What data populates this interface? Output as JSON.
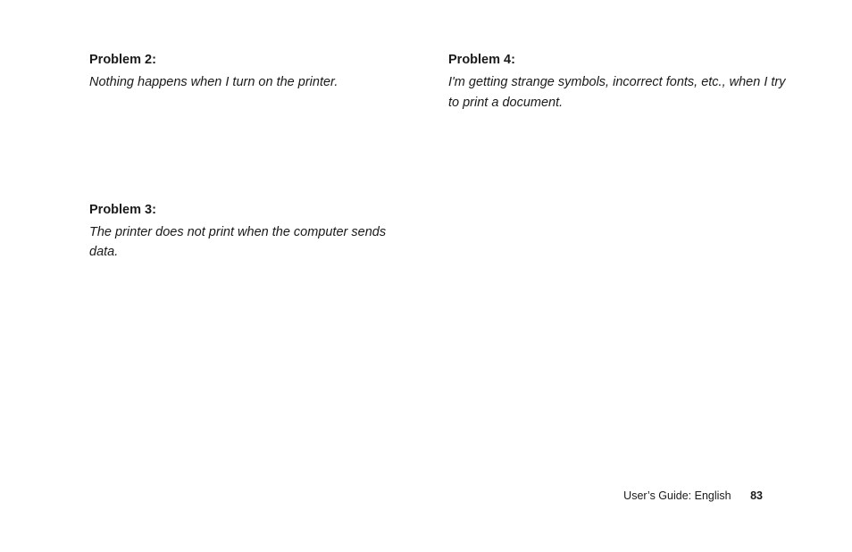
{
  "left": {
    "problem2": {
      "title": "Problem 2:",
      "desc": "Nothing happens when I turn on the printer."
    },
    "problem3": {
      "title": "Problem 3:",
      "desc": "The printer does not print when the computer sends data."
    }
  },
  "right": {
    "problem4": {
      "title": "Problem 4:",
      "desc": "I'm getting strange symbols, incorrect fonts, etc., when I try to print a document."
    }
  },
  "footer": {
    "label": "User’s Guide:  English",
    "page": "83"
  }
}
